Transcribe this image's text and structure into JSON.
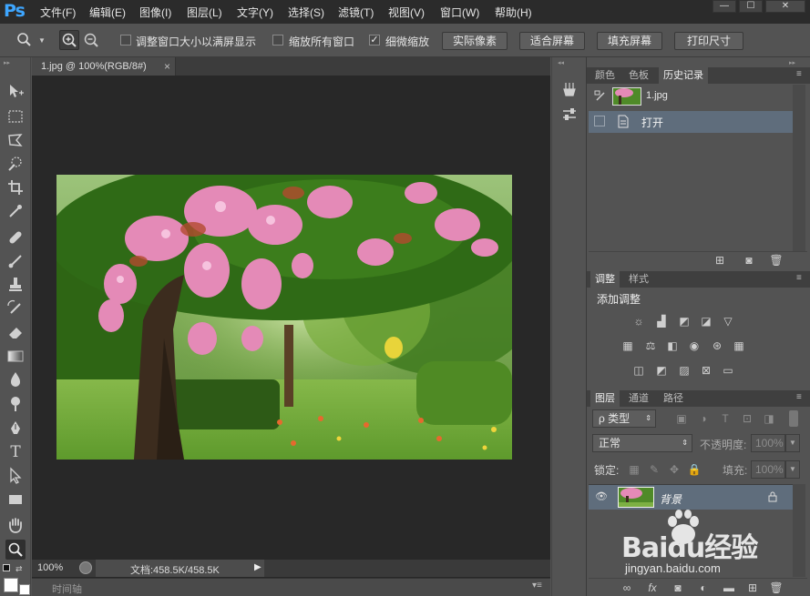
{
  "app": {
    "logo": "Ps"
  },
  "menu": [
    "文件(F)",
    "编辑(E)",
    "图像(I)",
    "图层(L)",
    "文字(Y)",
    "选择(S)",
    "滤镜(T)",
    "视图(V)",
    "窗口(W)",
    "帮助(H)"
  ],
  "window_controls": {
    "minimize": "—",
    "restore": "☐",
    "close": "✕"
  },
  "options": {
    "resize_windows": {
      "label": "调整窗口大小以满屏显示",
      "checked": false
    },
    "zoom_all": {
      "label": "缩放所有窗口",
      "checked": false
    },
    "scrubby_zoom": {
      "label": "细微缩放",
      "checked": true,
      "mark": "✓"
    },
    "buttons": [
      "实际像素",
      "适合屏幕",
      "填充屏幕",
      "打印尺寸"
    ]
  },
  "document": {
    "tab_title": "1.jpg @ 100%(RGB/8#)",
    "tab_close": "×",
    "zoom": "100%",
    "doc_size": "文档:458.5K/458.5K",
    "status_arrow": "▶",
    "timeline": "时间轴"
  },
  "panels": {
    "top_tabs": [
      "颜色",
      "色板",
      "历史记录"
    ],
    "history": {
      "snapshot_name": "1.jpg",
      "items": [
        "打开"
      ]
    },
    "adjust_tabs": [
      "调整",
      "样式"
    ],
    "adjust_title": "添加调整",
    "layers_tabs": [
      "图层",
      "通道",
      "路径"
    ],
    "layers": {
      "filter_kind": "ρ 类型",
      "blend_mode": "正常",
      "opacity_label": "不透明度:",
      "opacity_value": "100%",
      "lock_label": "锁定:",
      "fill_label": "填充:",
      "fill_value": "100%",
      "items": [
        {
          "name": "背景"
        }
      ]
    }
  },
  "watermark": {
    "brand": "Baidu经验",
    "url": "jingyan.baidu.com"
  },
  "colors": {
    "accent": "#3ea6ff",
    "selected_row": "#5f6d7c",
    "app_bg": "#535353",
    "doc_bg": "#282828"
  }
}
